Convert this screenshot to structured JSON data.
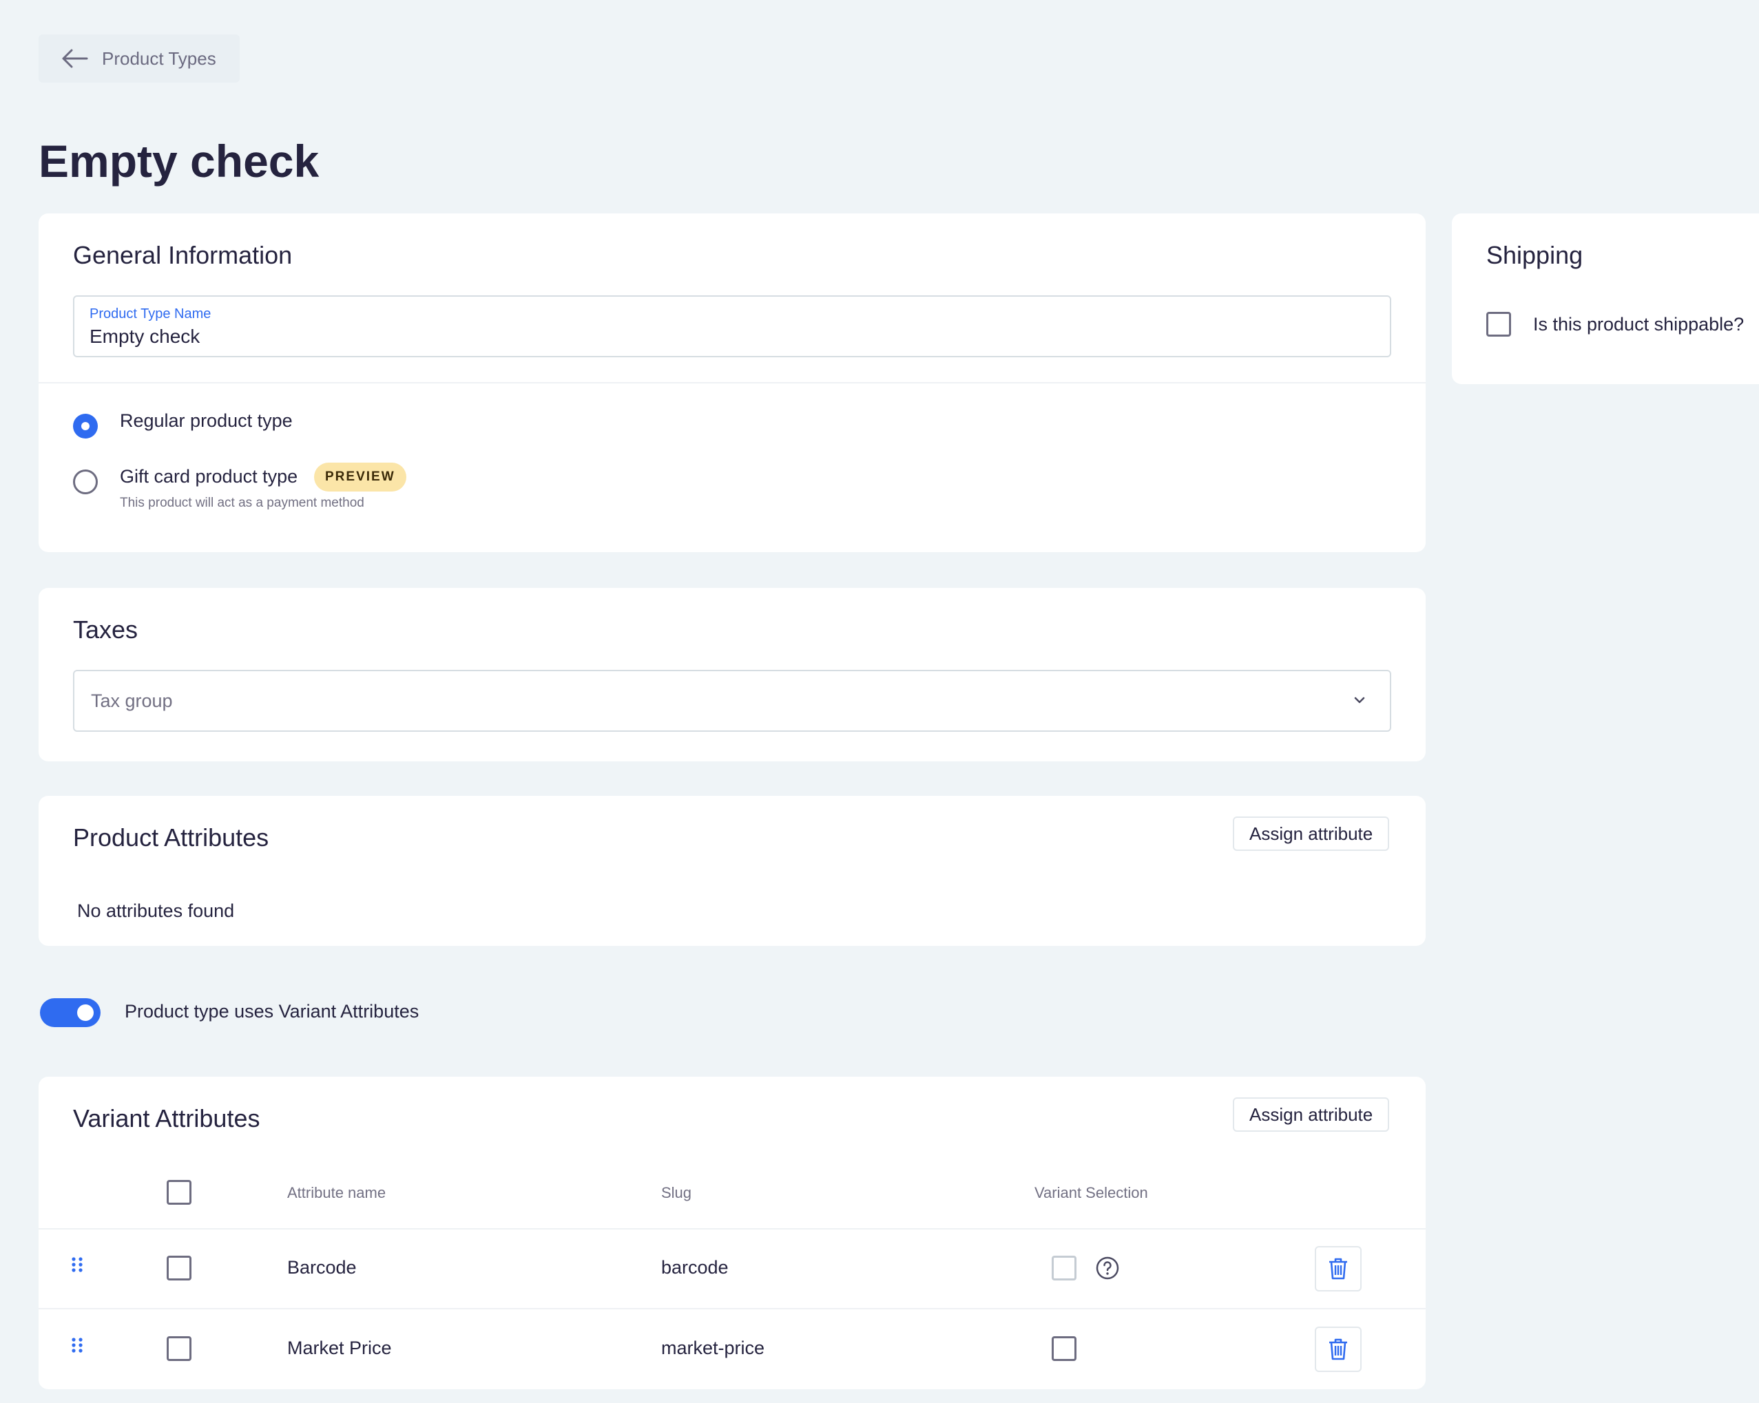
{
  "nav": {
    "back_label": "Product Types"
  },
  "page": {
    "title": "Empty check"
  },
  "general": {
    "title": "General Information",
    "name_field": {
      "label": "Product Type Name",
      "value": "Empty check"
    },
    "types": [
      {
        "label": "Regular product type",
        "selected": true
      },
      {
        "label": "Gift card product type",
        "badge": "PREVIEW",
        "description": "This product will act as a payment method",
        "selected": false
      }
    ]
  },
  "taxes": {
    "title": "Taxes",
    "placeholder": "Tax group"
  },
  "product_attributes": {
    "title": "Product Attributes",
    "assign_label": "Assign attribute",
    "empty_message": "No attributes found"
  },
  "variant_toggle": {
    "label": "Product type uses Variant Attributes",
    "on": true
  },
  "variant_attributes": {
    "title": "Variant Attributes",
    "assign_label": "Assign attribute",
    "columns": [
      "Attribute name",
      "Slug",
      "Variant Selection"
    ],
    "rows": [
      {
        "name": "Barcode",
        "slug": "barcode"
      },
      {
        "name": "Market Price",
        "slug": "market-price"
      }
    ]
  },
  "shipping": {
    "title": "Shipping",
    "checkbox_label": "Is this product shippable?"
  },
  "colors": {
    "accent": "#2f6bf0",
    "background": "#eff4f7",
    "badge": "#fbe5a8"
  },
  "icons": {
    "back": "arrow-left-icon",
    "drag": "drag-handle-icon",
    "help": "help-icon",
    "delete": "trash-icon",
    "select": "chevron-down-icon"
  }
}
